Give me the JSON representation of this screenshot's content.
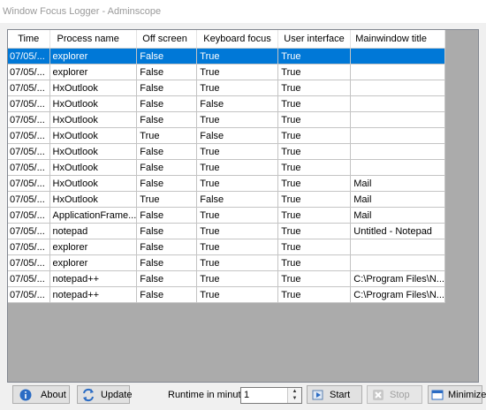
{
  "window": {
    "title": "Window Focus Logger - Adminscope"
  },
  "grid": {
    "columns": [
      "Time",
      "Process name",
      "Off screen",
      "Keyboard focus",
      "User interface",
      "Mainwindow title"
    ],
    "selected_row": 0,
    "rows": [
      [
        "07/05/...",
        "explorer",
        "False",
        "True",
        "True",
        ""
      ],
      [
        "07/05/...",
        "explorer",
        "False",
        "True",
        "True",
        ""
      ],
      [
        "07/05/...",
        "HxOutlook",
        "False",
        "True",
        "True",
        ""
      ],
      [
        "07/05/...",
        "HxOutlook",
        "False",
        "False",
        "True",
        ""
      ],
      [
        "07/05/...",
        "HxOutlook",
        "False",
        "True",
        "True",
        ""
      ],
      [
        "07/05/...",
        "HxOutlook",
        "True",
        "False",
        "True",
        ""
      ],
      [
        "07/05/...",
        "HxOutlook",
        "False",
        "True",
        "True",
        ""
      ],
      [
        "07/05/...",
        "HxOutlook",
        "False",
        "True",
        "True",
        ""
      ],
      [
        "07/05/...",
        "HxOutlook",
        "False",
        "True",
        "True",
        "Mail"
      ],
      [
        "07/05/...",
        "HxOutlook",
        "True",
        "False",
        "True",
        "Mail"
      ],
      [
        "07/05/...",
        "ApplicationFrame...",
        "False",
        "True",
        "True",
        "Mail"
      ],
      [
        "07/05/...",
        "notepad",
        "False",
        "True",
        "True",
        "Untitled - Notepad"
      ],
      [
        "07/05/...",
        "explorer",
        "False",
        "True",
        "True",
        ""
      ],
      [
        "07/05/...",
        "explorer",
        "False",
        "True",
        "True",
        ""
      ],
      [
        "07/05/...",
        "notepad++",
        "False",
        "True",
        "True",
        "C:\\Program Files\\N..."
      ],
      [
        "07/05/...",
        "notepad++",
        "False",
        "True",
        "True",
        "C:\\Program Files\\N..."
      ]
    ]
  },
  "toolbar": {
    "about_label": "About",
    "update_label": "Update",
    "runtime_label": "Runtime in minutes",
    "runtime_value": "1",
    "start_label": "Start",
    "stop_label": "Stop",
    "minimize_label": "Minimize"
  },
  "colors": {
    "selection": "#0078d7",
    "grid_background": "#ababab"
  }
}
